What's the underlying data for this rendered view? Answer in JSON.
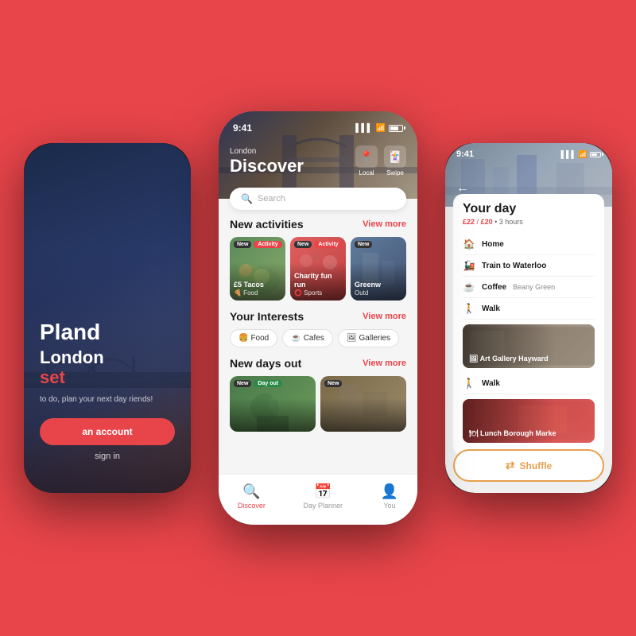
{
  "app": {
    "name": "Pland"
  },
  "background_color": "#e8454a",
  "phones": {
    "left": {
      "title_partial": "Pland",
      "city": "London",
      "subtitle": "set",
      "description": "to do, plan your next day\nriends!",
      "btn_create": "an account",
      "btn_signin": "sign in"
    },
    "middle": {
      "status_time": "9:41",
      "location_city": "London",
      "location_title": "Discover",
      "btn_local": "Local",
      "btn_swipe": "Swipe",
      "search_placeholder": "Search",
      "sections": {
        "activities": {
          "title": "New activities",
          "view_more": "View more",
          "items": [
            {
              "badge1": "New",
              "badge2": "Activity",
              "name": "£5 Tacos",
              "category": "Food",
              "emoji": "🍕"
            },
            {
              "badge1": "New",
              "badge2": "Activity",
              "name": "Charity fun run",
              "category": "Sports",
              "emoji": "⭕"
            },
            {
              "badge1": "New",
              "name": "Greenw",
              "category": "Outd",
              "emoji": ""
            }
          ]
        },
        "interests": {
          "title": "Your Interests",
          "view_more": "View more",
          "chips": [
            {
              "label": "Food",
              "emoji": "🍔"
            },
            {
              "label": "Cafes",
              "emoji": "☕"
            },
            {
              "label": "Galleries",
              "emoji": "🖼"
            }
          ]
        },
        "days_out": {
          "title": "New days out",
          "view_more": "View more",
          "items": [
            {
              "badge1": "New",
              "badge2": "Day out"
            },
            {
              "badge1": "New"
            }
          ]
        }
      },
      "tabs": [
        {
          "label": "Discover",
          "icon": "🔍",
          "active": true
        },
        {
          "label": "Day Planner",
          "icon": "📅",
          "active": false
        },
        {
          "label": "You",
          "icon": "👤",
          "active": false
        }
      ]
    },
    "right": {
      "status_time": "9:41",
      "day_title": "Your day",
      "price_spent": "£22",
      "price_budget": "£20",
      "duration": "3 hours",
      "itinerary": [
        {
          "icon": "🏠",
          "name": "Home",
          "sub": ""
        },
        {
          "icon": "🚂",
          "name": "Train to Waterloo",
          "sub": ""
        },
        {
          "icon": "☕",
          "name": "Coffee",
          "sub": "Beany Green"
        },
        {
          "icon": "🚶",
          "name": "Walk",
          "sub": ""
        },
        {
          "icon": "🖼",
          "name": "Art Gallery",
          "sub": "Hayward",
          "is_card": true
        },
        {
          "icon": "🚶",
          "name": "Walk",
          "sub": ""
        },
        {
          "icon": "🍽",
          "name": "Lunch",
          "sub": "Borough Marke",
          "is_card": true
        }
      ],
      "shuffle_label": "Shuffle"
    }
  }
}
